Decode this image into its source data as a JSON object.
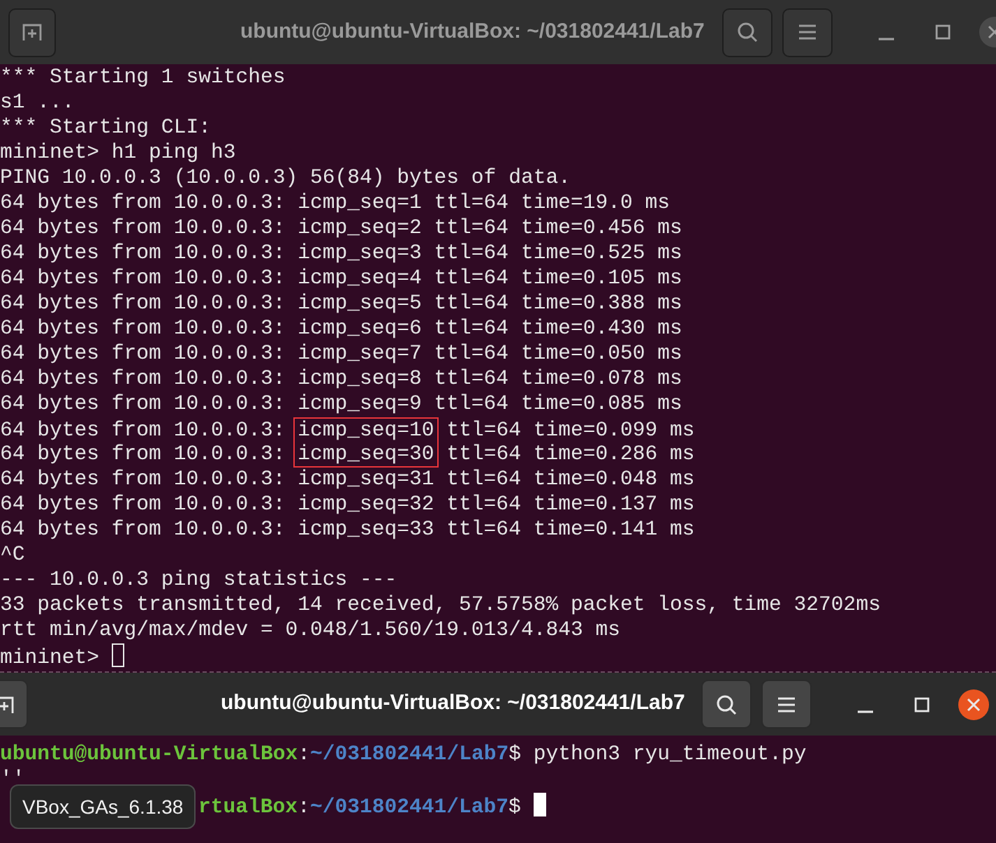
{
  "windows": [
    {
      "title": "ubuntu@ubuntu-VirtualBox: ~/031802441/Lab7",
      "active": false,
      "lines": [
        {
          "text": "*** Starting 1 switches"
        },
        {
          "text": "s1 ..."
        },
        {
          "text": "*** Starting CLI:"
        },
        {
          "text": "mininet> h1 ping h3"
        },
        {
          "text": "PING 10.0.0.3 (10.0.0.3) 56(84) bytes of data."
        },
        {
          "text": "64 bytes from 10.0.0.3: icmp_seq=1 ttl=64 time=19.0 ms"
        },
        {
          "text": "64 bytes from 10.0.0.3: icmp_seq=2 ttl=64 time=0.456 ms"
        },
        {
          "text": "64 bytes from 10.0.0.3: icmp_seq=3 ttl=64 time=0.525 ms"
        },
        {
          "text": "64 bytes from 10.0.0.3: icmp_seq=4 ttl=64 time=0.105 ms"
        },
        {
          "text": "64 bytes from 10.0.0.3: icmp_seq=5 ttl=64 time=0.388 ms"
        },
        {
          "text": "64 bytes from 10.0.0.3: icmp_seq=6 ttl=64 time=0.430 ms"
        },
        {
          "text": "64 bytes from 10.0.0.3: icmp_seq=7 ttl=64 time=0.050 ms"
        },
        {
          "text": "64 bytes from 10.0.0.3: icmp_seq=8 ttl=64 time=0.078 ms"
        },
        {
          "text": "64 bytes from 10.0.0.3: icmp_seq=9 ttl=64 time=0.085 ms"
        },
        {
          "segments": [
            {
              "text": "64 bytes from 10.0.0.3: "
            },
            {
              "text": "icmp_seq=10",
              "boxed": true
            },
            {
              "text": " ttl=64 time=0.099 ms"
            }
          ]
        },
        {
          "segments": [
            {
              "text": "64 bytes from 10.0.0.3: "
            },
            {
              "text": "icmp_seq=30",
              "boxed": true
            },
            {
              "text": " ttl=64 time=0.286 ms"
            }
          ]
        },
        {
          "text": "64 bytes from 10.0.0.3: icmp_seq=31 ttl=64 time=0.048 ms"
        },
        {
          "text": "64 bytes from 10.0.0.3: icmp_seq=32 ttl=64 time=0.137 ms"
        },
        {
          "text": "64 bytes from 10.0.0.3: icmp_seq=33 ttl=64 time=0.141 ms"
        },
        {
          "text": "^C"
        },
        {
          "text": "--- 10.0.0.3 ping statistics ---"
        },
        {
          "text": "33 packets transmitted, 14 received, 57.5758% packet loss, time 32702ms"
        },
        {
          "text": "rtt min/avg/max/mdev = 0.048/1.560/19.013/4.843 ms"
        },
        {
          "text": "mininet> ",
          "cursor": true
        }
      ]
    },
    {
      "title": "ubuntu@ubuntu-VirtualBox: ~/031802441/Lab7",
      "active": true,
      "lines": [
        {
          "segments": [
            {
              "text": "ubuntu@ubuntu-VirtualBox",
              "kind": "user"
            },
            {
              "text": ":",
              "kind": "plain"
            },
            {
              "text": "~/031802441/Lab7",
              "kind": "path"
            },
            {
              "text": "$ python3 ryu_timeout.py",
              "kind": "plain"
            }
          ]
        },
        {
          "text": "''"
        },
        {
          "indent": true,
          "segments": [
            {
              "text": "rtualBox",
              "kind": "user"
            },
            {
              "text": ":",
              "kind": "plain"
            },
            {
              "text": "~/031802441/Lab7",
              "kind": "path"
            },
            {
              "text": "$ ",
              "kind": "plain"
            }
          ],
          "cursor": true
        }
      ]
    }
  ],
  "tooltip": {
    "text": "VBox_GAs_6.1.38"
  }
}
